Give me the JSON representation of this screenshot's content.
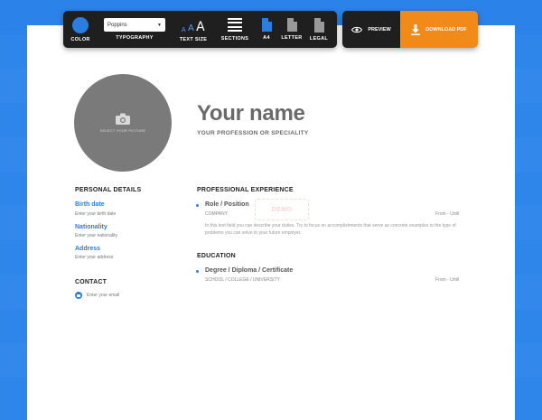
{
  "colors": {
    "background": "#2f86ea",
    "accent": "#2b7de0",
    "download": "#f28a1a",
    "toolbar": "#1f1f1f"
  },
  "toolbar": {
    "color_label": "COLOR",
    "font_value": "Poppins",
    "typography_label": "TYPOGRAPHY",
    "text_size_label": "TEXT SIZE",
    "sections_label": "SECTIONS",
    "a4_label": "A4",
    "letter_label": "LETTER",
    "legal_label": "LEGAL"
  },
  "actions": {
    "preview_label": "PREVIEW",
    "download_label": "DOWNLOAD PDF"
  },
  "resume": {
    "photo_label": "SELECT YOUR PICTURE",
    "name": "Your name",
    "profession": "YOUR PROFESSION OR SPECIALITY",
    "personal": {
      "title": "PERSONAL DETAILS",
      "birth_label": "Birth date",
      "birth_value": "Enter your birth date",
      "nationality_label": "Nationality",
      "nationality_value": "Enter your nationality",
      "address_label": "Address",
      "address_value": "Enter your address"
    },
    "contact": {
      "title": "CONTACT",
      "email_value": "Enter your email"
    },
    "experience": {
      "title": "PROFESSIONAL EXPERIENCE",
      "role": "Role / Position",
      "company": "COMPANY",
      "dates": "From - Until",
      "description": "In this text field you can describe your duties. Try to focus on accomplishments that serve as concrete examples to the type of problems you can solve to your future employer."
    },
    "education": {
      "title": "EDUCATION",
      "degree": "Degree / Diploma / Certificate",
      "school": "SCHOOL / COLLEGE / UNIVERSITY",
      "dates": "From - Until"
    }
  }
}
